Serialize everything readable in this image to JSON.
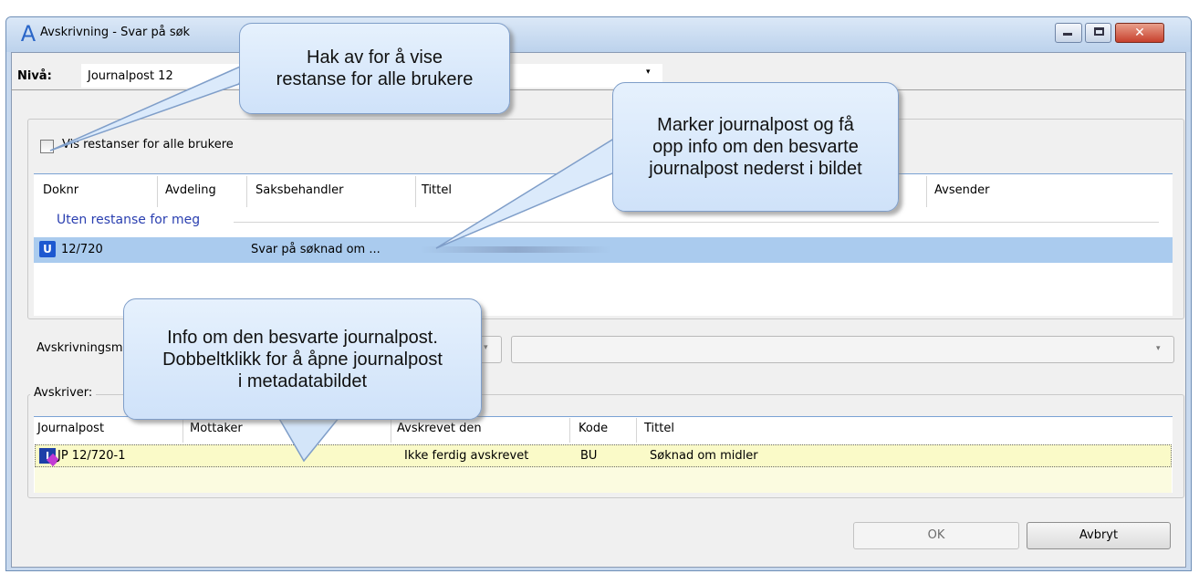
{
  "window": {
    "title": "Avskrivning - Svar på  søk",
    "app_icon_glyph": "A",
    "close_glyph": "✕"
  },
  "level": {
    "label": "Nivå:",
    "value": "Journalpost 12",
    "arrow": "▾"
  },
  "filter": {
    "show_all_label": "Vis restanser for alle brukere",
    "checked": false
  },
  "grid1": {
    "columns": [
      "Doknr",
      "Avdeling",
      "Saksbehandler",
      "Tittel",
      "Avsender"
    ],
    "group_header": "Uten restanse for meg",
    "rows": [
      {
        "icon": "U",
        "icon_name": "outgoing-document-icon",
        "doknr": "12/720",
        "title": "Svar på  søknad om ...",
        "selected": true
      }
    ]
  },
  "avskrivningsmate": {
    "label": "Avskrivningsm",
    "arrow": "▾"
  },
  "avskriver": {
    "legend": "Avskriver:",
    "columns": [
      "Journalpost",
      "Mottaker",
      "Avskrevet den",
      "Kode",
      "Tittel"
    ],
    "rows": [
      {
        "icon": "I",
        "icon_name": "incoming-document-icon",
        "journalpost": "JP 12/720-1",
        "avskrevet_den": "Ikke ferdig avskrevet",
        "kode": "BU",
        "tittel": "Søknad om midler"
      }
    ]
  },
  "buttons": {
    "ok": "OK",
    "cancel": "Avbryt"
  },
  "callouts": {
    "c1": [
      "Hak av for å vise",
      "restanse for alle brukere"
    ],
    "c2": [
      "Marker journalpost og få",
      "opp info om den besvarte",
      "journalpost nederst i bildet"
    ],
    "c3": [
      "Info om den besvarte journalpost.",
      "Dobbeltklikk for å åpne journalpost",
      "i metadatabildet"
    ]
  },
  "colors": {
    "selection": "#aacbee",
    "group_header": "#2a3fb0",
    "reply_row": "#fafac8",
    "callout_fill": "#dbeafb",
    "callout_border": "#7f9ec9"
  }
}
